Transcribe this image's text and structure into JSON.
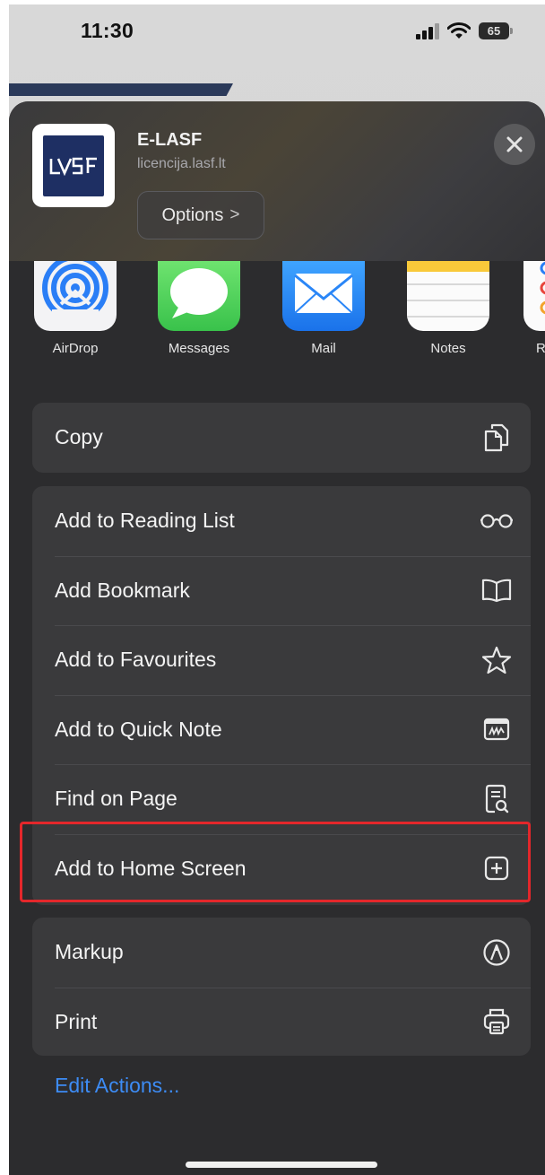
{
  "status_bar": {
    "time": "11:30",
    "battery": "65"
  },
  "header": {
    "title": "E-LASF",
    "url": "licencija.lasf.lt",
    "options_label": "Options",
    "options_chevron": ">"
  },
  "share_targets": [
    {
      "label": "AirDrop",
      "icon": "airdrop-icon"
    },
    {
      "label": "Messages",
      "icon": "messages-icon"
    },
    {
      "label": "Mail",
      "icon": "mail-icon"
    },
    {
      "label": "Notes",
      "icon": "notes-icon"
    },
    {
      "label": "R",
      "icon": "reminders-icon"
    }
  ],
  "actions": {
    "group1": [
      {
        "label": "Copy",
        "icon": "copy-icon"
      }
    ],
    "group2": [
      {
        "label": "Add to Reading List",
        "icon": "glasses-icon"
      },
      {
        "label": "Add Bookmark",
        "icon": "book-icon"
      },
      {
        "label": "Add to Favourites",
        "icon": "star-icon"
      },
      {
        "label": "Add to Quick Note",
        "icon": "quick-note-icon"
      },
      {
        "label": "Find on Page",
        "icon": "find-on-page-icon"
      },
      {
        "label": "Add to Home Screen",
        "icon": "add-square-icon"
      }
    ],
    "group3": [
      {
        "label": "Markup",
        "icon": "markup-icon"
      },
      {
        "label": "Print",
        "icon": "printer-icon"
      }
    ]
  },
  "edit_actions_label": "Edit Actions...",
  "colors": {
    "sheet": "#2c2c2e",
    "row": "#3a3a3c",
    "link": "#3d8cf5",
    "highlight": "#e4272b"
  }
}
